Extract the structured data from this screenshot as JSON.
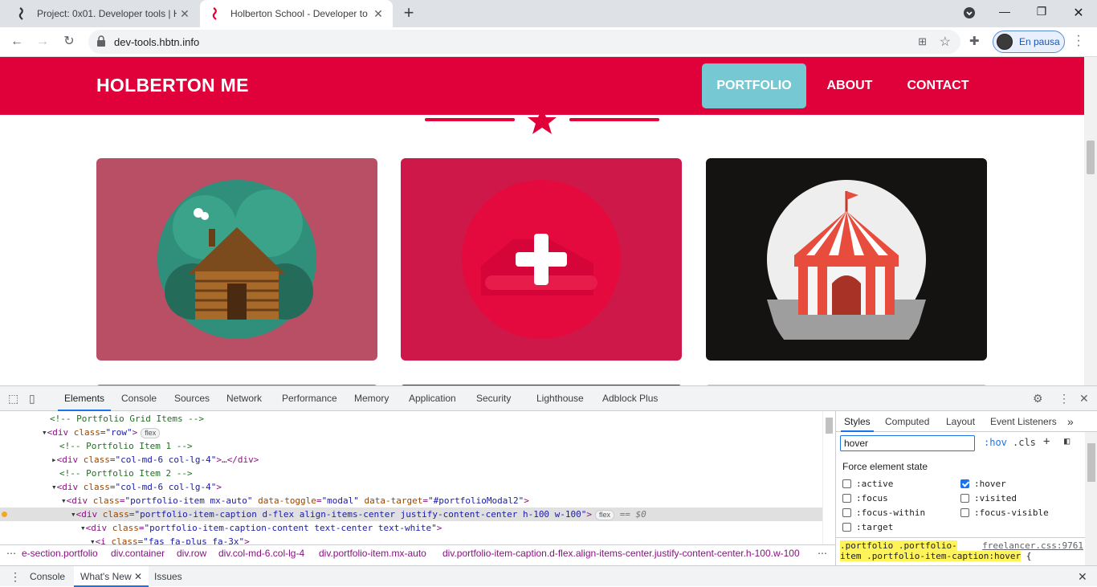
{
  "browser": {
    "tabs": [
      {
        "title": "Project: 0x01. Developer tools | H",
        "favicon": "holberton-favicon",
        "close": "✕"
      },
      {
        "title": "Holberton School - Developer to",
        "favicon": "holberton-favicon-red",
        "close": "✕"
      }
    ],
    "new_tab": "+",
    "window_controls": {
      "minimize": "—",
      "maximize": "❐",
      "close": "✕"
    },
    "url": "dev-tools.hbtn.info",
    "profile_label": "En pausa"
  },
  "page": {
    "brand": "HOLBERTON ME",
    "nav": {
      "portfolio": "PORTFOLIO",
      "about": "ABOUT",
      "contact": "CONTACT"
    },
    "colors": {
      "primary": "#e0003a",
      "nav_active": "#76c9d3",
      "card1": "#b94f65",
      "card2": "#ce1849",
      "card3": "#151212"
    },
    "cards": [
      {
        "icon": "log-cabin-icon"
      },
      {
        "icon": "plus-icon"
      },
      {
        "icon": "circus-tent-icon"
      }
    ]
  },
  "devtools": {
    "tabs": [
      "Elements",
      "Console",
      "Sources",
      "Network",
      "Performance",
      "Memory",
      "Application",
      "Security",
      "Lighthouse",
      "Adblock Plus"
    ],
    "dom_lines": [
      {
        "comment": "<!-- Portfolio Grid Items -->"
      },
      {
        "tag": "<div",
        "attr": "class",
        "val": "\"row\"",
        "end": ">",
        "pill": "flex"
      },
      {
        "comment": "<!-- Portfolio Item 1 -->"
      },
      {
        "tag": "<div",
        "attr": "class",
        "val": "\"col-md-6 col-lg-4\"",
        "end": ">…</div>"
      },
      {
        "comment": "<!-- Portfolio Item 2 -->"
      },
      {
        "tag": "<div",
        "attr": "class",
        "val": "\"col-md-6 col-lg-4\"",
        "end": ">"
      },
      {
        "tag": "<div",
        "attr": "class",
        "val": "\"portfolio-item mx-auto\"",
        "attr2": "data-toggle",
        "val2": "\"modal\"",
        "attr3": "data-target",
        "val3": "\"#portfolioModal2\"",
        "end": ">"
      },
      {
        "tag": "<div",
        "attr": "class",
        "val": "\"portfolio-item-caption d-flex align-items-center justify-content-center h-100 w-100\"",
        "end": ">",
        "pill": "flex",
        "suffix": "== $0"
      },
      {
        "tag": "<div",
        "attr": "class",
        "val": "\"portfolio-item-caption-content text-center text-white\"",
        "end": ">"
      },
      {
        "tag": "<i",
        "attr": "class",
        "val": "\"fas fa-plus fa-3x\"",
        "end": ">"
      }
    ],
    "breadcrumbs": [
      "e-section.portfolio",
      "div.container",
      "div.row",
      "div.col-md-6.col-lg-4",
      "div.portfolio-item.mx-auto",
      "div.portfolio-item-caption.d-flex.align-items-center.justify-content-center.h-100.w-100"
    ],
    "styles": {
      "tabs": [
        "Styles",
        "Computed",
        "Layout",
        "Event Listeners"
      ],
      "filter_value": "hover",
      "hov": ":hov",
      "cls": ".cls",
      "force_title": "Force element state",
      "states": [
        {
          "label": ":active",
          "checked": false
        },
        {
          "label": ":hover",
          "checked": true
        },
        {
          "label": ":focus",
          "checked": false
        },
        {
          "label": ":visited",
          "checked": false
        },
        {
          "label": ":focus-within",
          "checked": false
        },
        {
          "label": ":focus-visible",
          "checked": false
        },
        {
          "label": ":target",
          "checked": false
        }
      ],
      "rule_selector_1": ".portfolio .portfolio-",
      "rule_selector_2": "item .portfolio-item-caption:hover",
      "rule_brace": "{",
      "rule_source": "freelancer.css:9761"
    },
    "drawer": {
      "console": "Console",
      "whats_new": "What's New",
      "issues": "Issues",
      "close": "✕"
    }
  }
}
